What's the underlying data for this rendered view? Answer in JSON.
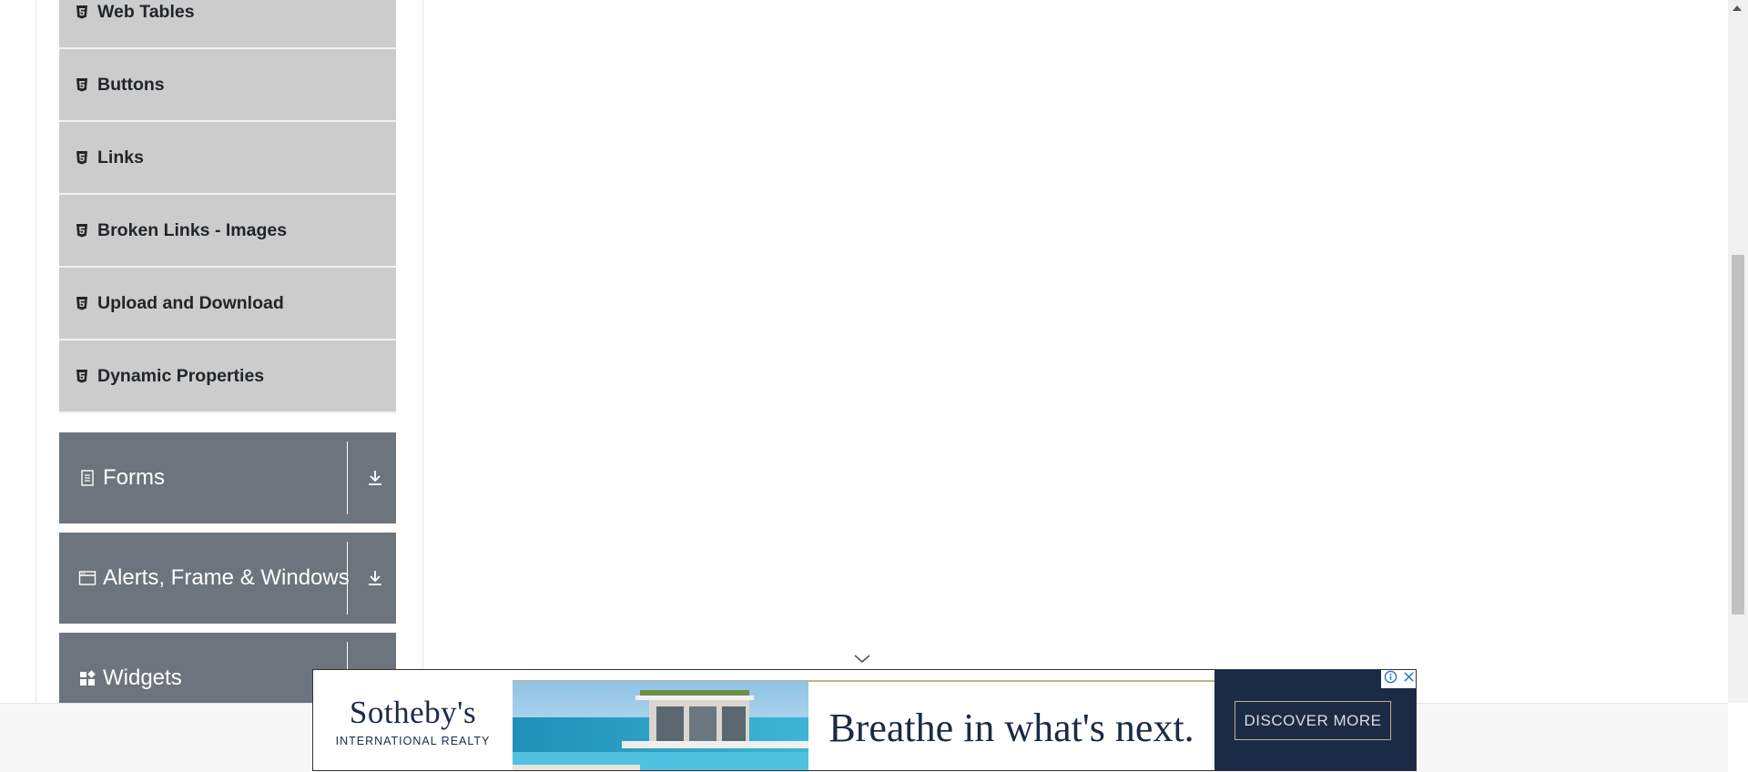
{
  "sidebar": {
    "sub_items": [
      {
        "label": "Web Tables",
        "icon": "html5-icon"
      },
      {
        "label": "Buttons",
        "icon": "html5-icon"
      },
      {
        "label": "Links",
        "icon": "html5-icon"
      },
      {
        "label": "Broken Links - Images",
        "icon": "html5-icon"
      },
      {
        "label": "Upload and Download",
        "icon": "html5-icon"
      },
      {
        "label": "Dynamic Properties",
        "icon": "html5-icon"
      }
    ],
    "groups": [
      {
        "label": "Forms",
        "icon": "document-icon"
      },
      {
        "label": "Alerts, Frame & Windows",
        "icon": "window-icon"
      },
      {
        "label": "Widgets",
        "icon": "widgets-icon"
      }
    ]
  },
  "ad": {
    "brand": "Sotheby's",
    "brand_sub": "INTERNATIONAL REALTY",
    "tagline": "Breathe in what's next.",
    "cta": "DISCOVER MORE"
  },
  "colors": {
    "sub_item_bg": "#cccccc",
    "group_bg": "#6c757d",
    "ad_navy": "#1b2a45",
    "ad_gold": "#c8b27c"
  }
}
